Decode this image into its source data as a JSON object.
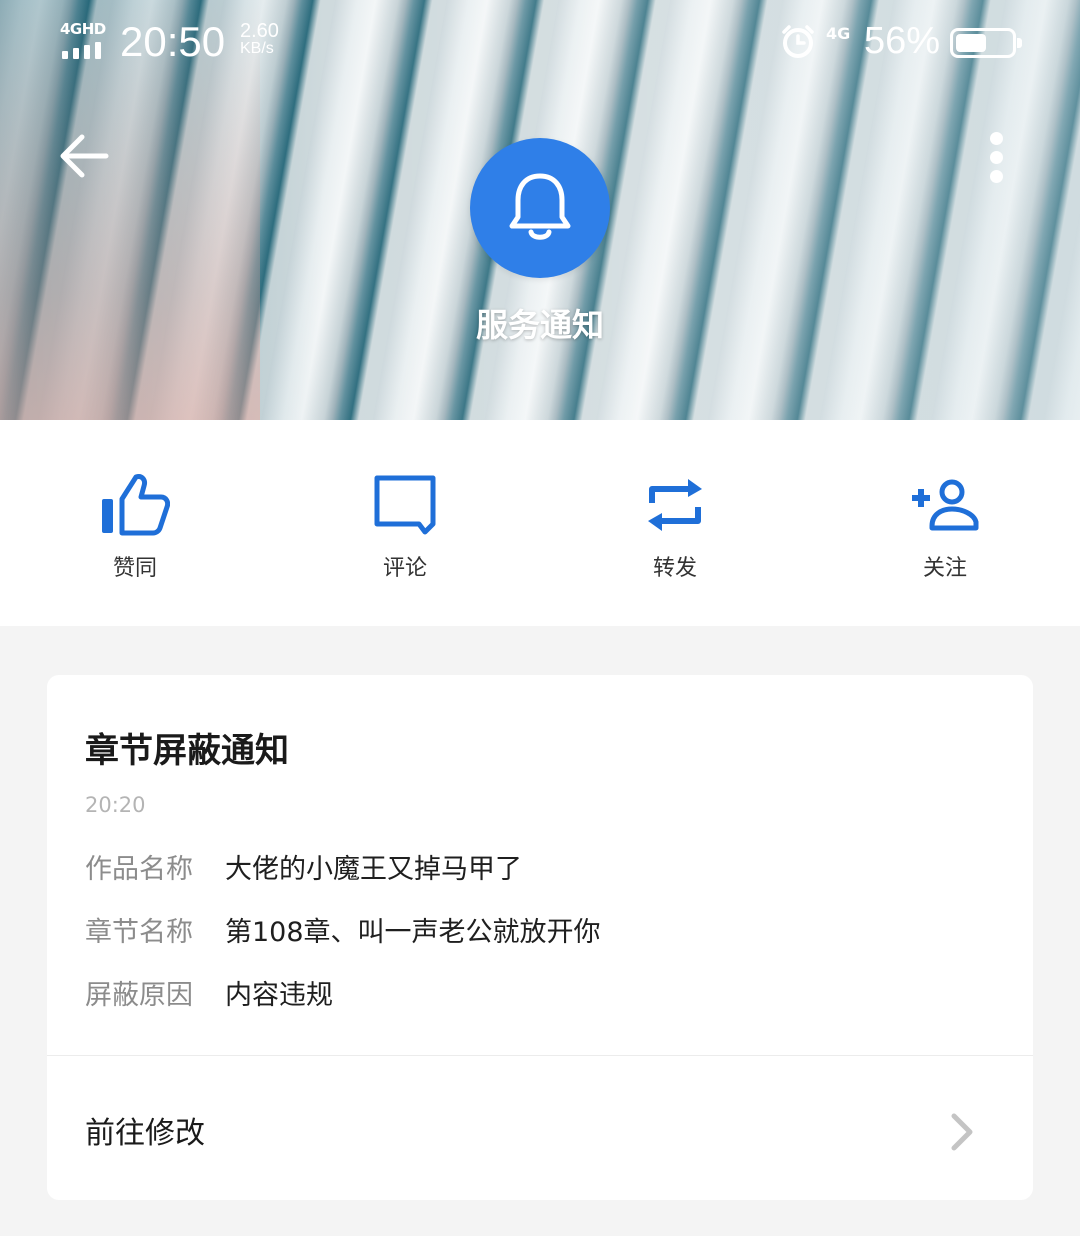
{
  "status_bar": {
    "network": "4GHD",
    "time": "20:50",
    "speed_value": "2.60",
    "speed_unit": "KB/s",
    "mobile_type": "4G",
    "battery_percent": "56%",
    "battery_level": 0.56
  },
  "header": {
    "title": "服务通知",
    "icon": "bell-icon",
    "accent_color": "#2f7fe8"
  },
  "actions": [
    {
      "label": "赞同",
      "icon": "thumbs-up-icon"
    },
    {
      "label": "评论",
      "icon": "comment-icon"
    },
    {
      "label": "转发",
      "icon": "repost-icon"
    },
    {
      "label": "关注",
      "icon": "add-user-icon"
    }
  ],
  "notice": {
    "title": "章节屏蔽通知",
    "time": "20:20",
    "fields": [
      {
        "key": "作品名称",
        "value": "大佬的小魔王又掉马甲了"
      },
      {
        "key": "章节名称",
        "value": "第108章、叫一声老公就放开你"
      },
      {
        "key": "屏蔽原因",
        "value": "内容违规"
      }
    ],
    "action_label": "前往修改"
  }
}
